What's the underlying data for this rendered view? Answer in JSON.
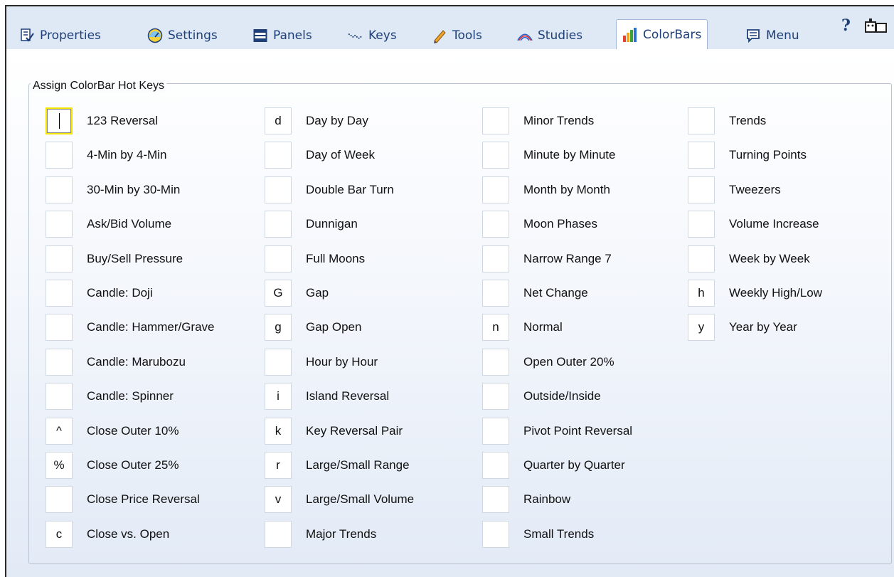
{
  "tabs": [
    {
      "label": "Properties",
      "icon": "properties-icon",
      "active": false
    },
    {
      "label": "Settings",
      "icon": "settings-icon",
      "active": false
    },
    {
      "label": "Panels",
      "icon": "panels-icon",
      "active": false
    },
    {
      "label": "Keys",
      "icon": "keys-icon",
      "active": false
    },
    {
      "label": "Tools",
      "icon": "tools-icon",
      "active": false
    },
    {
      "label": "Studies",
      "icon": "studies-icon",
      "active": false
    },
    {
      "label": "ColorBars",
      "icon": "colorbars-icon",
      "active": true
    },
    {
      "label": "Menu",
      "icon": "menu-icon",
      "active": false
    }
  ],
  "help_label": "?",
  "group_title": "Assign ColorBar Hot Keys",
  "columns": [
    [
      {
        "key": "",
        "label": "123 Reversal",
        "focused": true
      },
      {
        "key": "",
        "label": "4-Min by 4-Min"
      },
      {
        "key": "",
        "label": "30-Min by 30-Min"
      },
      {
        "key": "",
        "label": "Ask/Bid Volume"
      },
      {
        "key": "",
        "label": "Buy/Sell Pressure"
      },
      {
        "key": "",
        "label": "Candle: Doji"
      },
      {
        "key": "",
        "label": "Candle: Hammer/Grave"
      },
      {
        "key": "",
        "label": "Candle: Marubozu"
      },
      {
        "key": "",
        "label": "Candle: Spinner"
      },
      {
        "key": "^",
        "label": "Close Outer 10%"
      },
      {
        "key": "%",
        "label": "Close Outer 25%"
      },
      {
        "key": "",
        "label": "Close Price Reversal"
      },
      {
        "key": "c",
        "label": "Close vs. Open"
      }
    ],
    [
      {
        "key": "d",
        "label": "Day by Day"
      },
      {
        "key": "",
        "label": "Day of Week"
      },
      {
        "key": "",
        "label": "Double Bar Turn"
      },
      {
        "key": "",
        "label": "Dunnigan"
      },
      {
        "key": "",
        "label": "Full Moons"
      },
      {
        "key": "G",
        "label": "Gap"
      },
      {
        "key": "g",
        "label": "Gap Open"
      },
      {
        "key": "",
        "label": "Hour by Hour"
      },
      {
        "key": "i",
        "label": "Island Reversal"
      },
      {
        "key": "k",
        "label": "Key Reversal Pair"
      },
      {
        "key": "r",
        "label": "Large/Small Range"
      },
      {
        "key": "v",
        "label": "Large/Small Volume"
      },
      {
        "key": "",
        "label": "Major Trends"
      }
    ],
    [
      {
        "key": "",
        "label": "Minor Trends"
      },
      {
        "key": "",
        "label": "Minute by Minute"
      },
      {
        "key": "",
        "label": "Month by Month"
      },
      {
        "key": "",
        "label": "Moon Phases"
      },
      {
        "key": "",
        "label": "Narrow Range 7"
      },
      {
        "key": "",
        "label": "Net Change"
      },
      {
        "key": "n",
        "label": "Normal"
      },
      {
        "key": "",
        "label": "Open Outer 20%"
      },
      {
        "key": "",
        "label": "Outside/Inside"
      },
      {
        "key": "",
        "label": "Pivot Point Reversal"
      },
      {
        "key": "",
        "label": "Quarter by Quarter"
      },
      {
        "key": "",
        "label": "Rainbow"
      },
      {
        "key": "",
        "label": "Small Trends"
      }
    ],
    [
      {
        "key": "",
        "label": "Trends"
      },
      {
        "key": "",
        "label": "Turning Points"
      },
      {
        "key": "",
        "label": "Tweezers"
      },
      {
        "key": "",
        "label": "Volume Increase"
      },
      {
        "key": "",
        "label": "Week by Week"
      },
      {
        "key": "h",
        "label": "Weekly High/Low"
      },
      {
        "key": "y",
        "label": "Year by Year"
      }
    ]
  ]
}
